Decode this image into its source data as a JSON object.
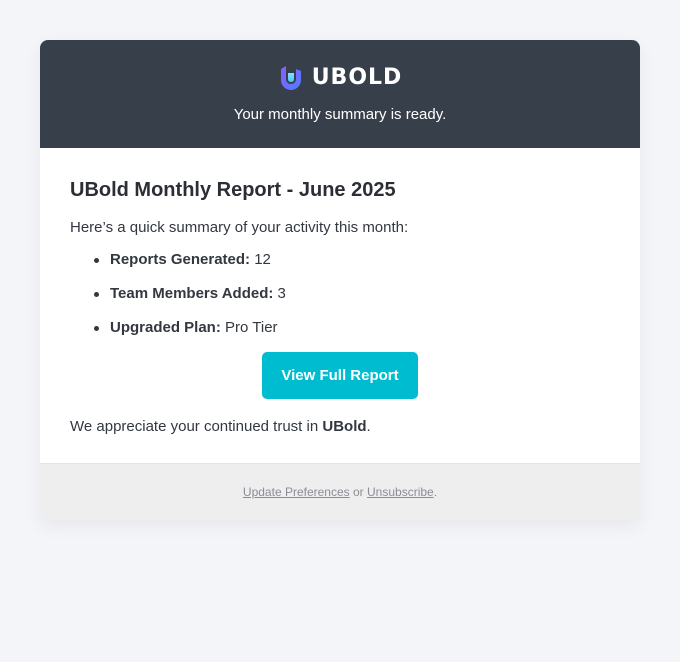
{
  "header": {
    "brand": "UBOLD",
    "tagline": "Your monthly summary is ready."
  },
  "content": {
    "title": "UBold Monthly Report - June 2025",
    "intro": "Here’s a quick summary of your activity this month:",
    "stats": [
      {
        "label": "Reports Generated:",
        "value": "12"
      },
      {
        "label": "Team Members Added:",
        "value": "3"
      },
      {
        "label": "Upgraded Plan:",
        "value": "Pro Tier"
      }
    ],
    "button_label": "View Full Report",
    "closing_prefix": "We appreciate your continued trust in ",
    "closing_brand": "UBold",
    "closing_suffix": "."
  },
  "footer": {
    "update_link": "Update Preferences",
    "separator": "or",
    "unsubscribe_link": "Unsubscribe",
    "suffix": "."
  },
  "colors": {
    "header_bg": "#37404a",
    "page_bg": "#f4f5f9",
    "button": "#00bcd0",
    "logo_gradient_start": "#7b61ff",
    "logo_gradient_end": "#4fc3f7"
  },
  "icons": {
    "logo": "ubold-logo-icon"
  }
}
